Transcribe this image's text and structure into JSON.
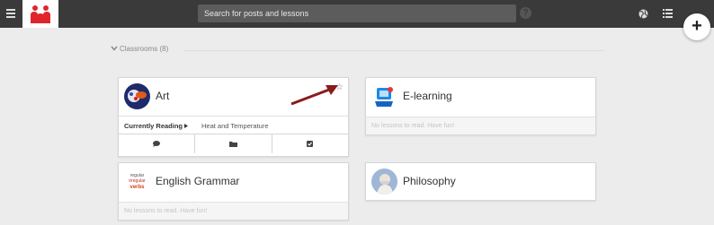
{
  "search": {
    "placeholder": "Search for posts and lessons"
  },
  "help": {
    "label": "?"
  },
  "plus": {
    "label": "+"
  },
  "section": {
    "title": "Classrooms (8)"
  },
  "classrooms": [
    {
      "title": "Art",
      "currently_reading_label": "Currently Reading",
      "current_lesson": "Heat and Temperature",
      "icons": [
        "comment-icon",
        "folder-icon",
        "checkbox-icon"
      ]
    },
    {
      "title": "E-learning",
      "footer": "No lessons to read. Have fun!"
    },
    {
      "title": "English Grammar",
      "footer": "No lessons to read. Have fun!",
      "avatar_text": [
        "regular",
        "irregular",
        "verbs"
      ]
    },
    {
      "title": "Philosophy"
    }
  ],
  "colors": {
    "topbar": "#3a3a3a",
    "logo_red": "#e0242b",
    "arrow": "#8b1a1a",
    "background": "#ececec"
  }
}
